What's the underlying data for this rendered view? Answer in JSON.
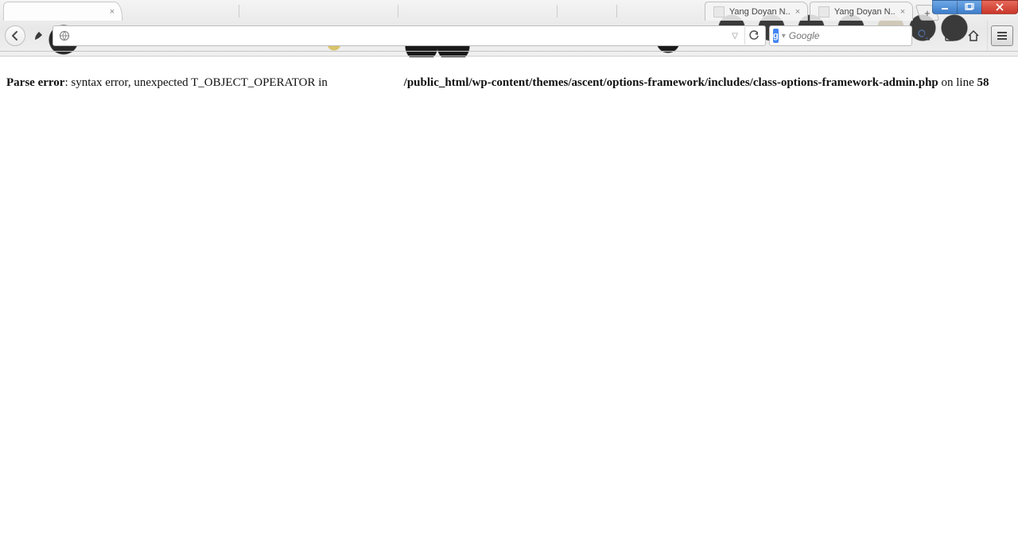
{
  "tabs": {
    "active": {
      "title": "",
      "has_close": true
    },
    "background": [
      {
        "title": "Yang Doyan N.."
      },
      {
        "title": "Yang Doyan N.."
      }
    ],
    "newtab_glyph": "+"
  },
  "window_controls": {
    "minimize": "minimize",
    "maximize": "maximize",
    "close": "close"
  },
  "navbar": {
    "back_tooltip": "Back",
    "identity_tooltip": "Site identity",
    "url_value": "",
    "reload_tooltip": "Reload",
    "drop_glyph": "▽"
  },
  "search": {
    "engine_letter": "g",
    "placeholder": "Google",
    "go_tooltip": "Search"
  },
  "toolbar": {
    "downloads_tooltip": "Downloads",
    "readinglist_tooltip": "Reading list",
    "home_tooltip": "Home",
    "menu_tooltip": "Open menu"
  },
  "error": {
    "label": "Parse error",
    "colon": ": ",
    "message": "syntax error, unexpected T_OBJECT_OPERATOR in ",
    "path": "/public_html/wp-content/themes/ascent/options-framework/includes/class-options-framework-admin.php",
    "on_line": " on line ",
    "line": "58"
  }
}
